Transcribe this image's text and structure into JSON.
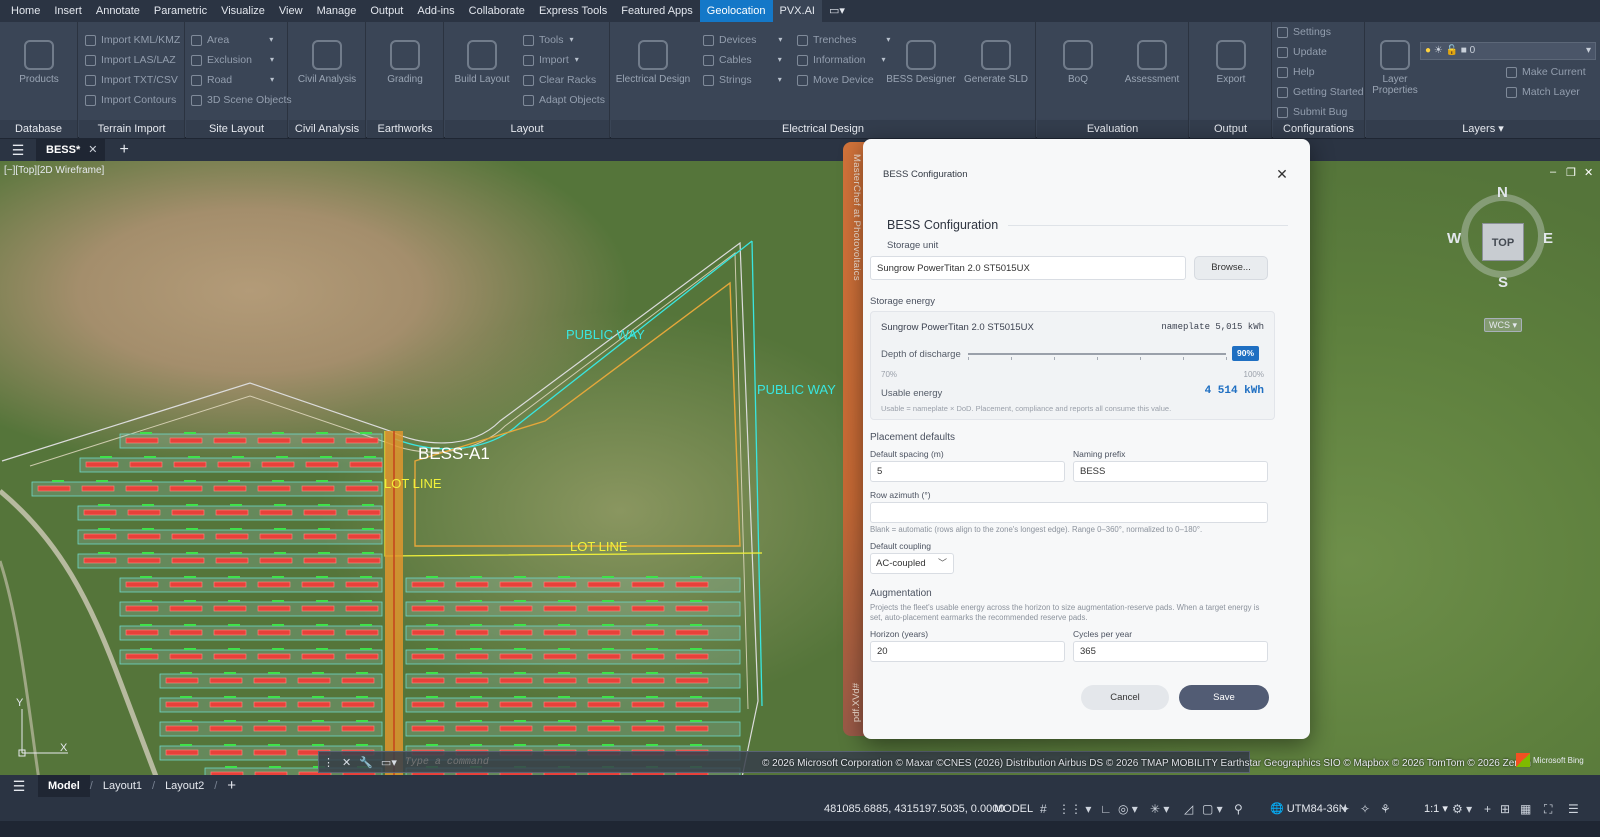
{
  "menu": [
    "Home",
    "Insert",
    "Annotate",
    "Parametric",
    "Visualize",
    "View",
    "Manage",
    "Output",
    "Add-ins",
    "Collaborate",
    "Express Tools",
    "Featured Apps",
    "Geolocation",
    "PVX.AI"
  ],
  "ribbon": {
    "database": {
      "title": "Database",
      "products": "Products"
    },
    "terrain": {
      "title": "Terrain Import",
      "items": [
        "Import KML/KMZ",
        "Import LAS/LAZ",
        "Import TXT/CSV",
        "Import Contours"
      ]
    },
    "site": {
      "title": "Site Layout",
      "items": [
        "Area",
        "Exclusion",
        "Road",
        "3D Scene Objects"
      ]
    },
    "civil": {
      "title": "Civil Analysis",
      "btn": "Civil Analysis"
    },
    "earth": {
      "title": "Earthworks",
      "btn": "Grading"
    },
    "layout": {
      "title": "Layout",
      "btn": "Build Layout",
      "items": [
        "Tools",
        "Import",
        "Clear Racks",
        "Adapt Objects"
      ]
    },
    "elec": {
      "title": "Electrical Design",
      "btn": "Electrical Design",
      "col1": [
        "Devices",
        "Cables",
        "Strings"
      ],
      "col2": [
        "Trenches",
        "Information",
        "Move Device"
      ],
      "bess": "BESS Designer",
      "sld": "Generate SLD"
    },
    "eval": {
      "title": "Evaluation",
      "boq": "BoQ",
      "assess": "Assessment"
    },
    "output": {
      "title": "Output",
      "export": "Export"
    },
    "config": {
      "title": "Configurations",
      "items": [
        "Settings",
        "Update",
        "Help",
        "Getting Started",
        "Submit Bug"
      ]
    },
    "layers": {
      "title": "Layers",
      "props": "Layer Properties",
      "make": "Make Current",
      "match": "Match Layer",
      "current": "0"
    }
  },
  "tabs": {
    "doc": "BESS*"
  },
  "viewport": {
    "label": "[−][Top][2D Wireframe]",
    "labels": {
      "public_way_1": "PUBLIC WAY",
      "public_way_2": "PUBLIC WAY",
      "lot_line_1": "LOT LINE",
      "lot_line_2": "LOT LINE",
      "bess": "BESS-A1"
    },
    "compass": {
      "n": "N",
      "s": "S",
      "e": "E",
      "w": "W",
      "top": "TOP"
    },
    "wcs": "WCS",
    "command_placeholder": "Type a command",
    "attribution": "© 2026 Microsoft Corporation © Maxar ©CNES (2026) Distribution Airbus DS © 2026 TMAP MOBILITY Earthstar Geographics SIO © Mapbox © 2026 TomTom © 2026 Zenrin",
    "bing": "Microsoft Bing",
    "ucs_x": "X",
    "ucs_y": "Y"
  },
  "layout_tabs": [
    "Model",
    "Layout1",
    "Layout2"
  ],
  "status": {
    "coords": "481085.6885, 4315197.5035, 0.0000",
    "model": "MODEL",
    "crs": "UTM84-36N",
    "scale": "1:1"
  },
  "dialog": {
    "side_top": "MasterChef at Photovoltaics",
    "side_bottom": "pdf.XVd#",
    "title": "BESS Configuration",
    "section": "BESS Configuration",
    "storage_unit_label": "Storage unit",
    "storage_unit_value": "Sungrow PowerTitan 2.0 ST5015UX",
    "browse": "Browse...",
    "storage_energy_label": "Storage energy",
    "energy": {
      "unit": "Sungrow PowerTitan 2.0 ST5015UX",
      "nameplate": "nameplate 5,015 kWh",
      "dod_label": "Depth of discharge",
      "dod_value": "90%",
      "dod_fraction": 0.9,
      "min": "70%",
      "max": "100%",
      "usable_label": "Usable energy",
      "usable_value": "4 514 kWh",
      "hint": "Usable = nameplate × DoD. Placement, compliance and reports all consume this value."
    },
    "placement_label": "Placement defaults",
    "spacing_label": "Default spacing (m)",
    "spacing_value": "5",
    "prefix_label": "Naming prefix",
    "prefix_value": "BESS",
    "azimuth_label": "Row azimuth (°)",
    "azimuth_value": "",
    "azimuth_hint": "Blank = automatic (rows align to the zone's longest edge). Range 0–360°, normalized to 0–180°.",
    "coupling_label": "Default coupling",
    "coupling_value": "AC-coupled",
    "aug_label": "Augmentation",
    "aug_hint": "Projects the fleet's usable energy across the horizon to size augmentation-reserve pads. When a target energy is set, auto-placement earmarks the recommended reserve pads.",
    "horizon_label": "Horizon (years)",
    "horizon_value": "20",
    "cycles_label": "Cycles per year",
    "cycles_value": "365",
    "cancel": "Cancel",
    "save": "Save"
  }
}
